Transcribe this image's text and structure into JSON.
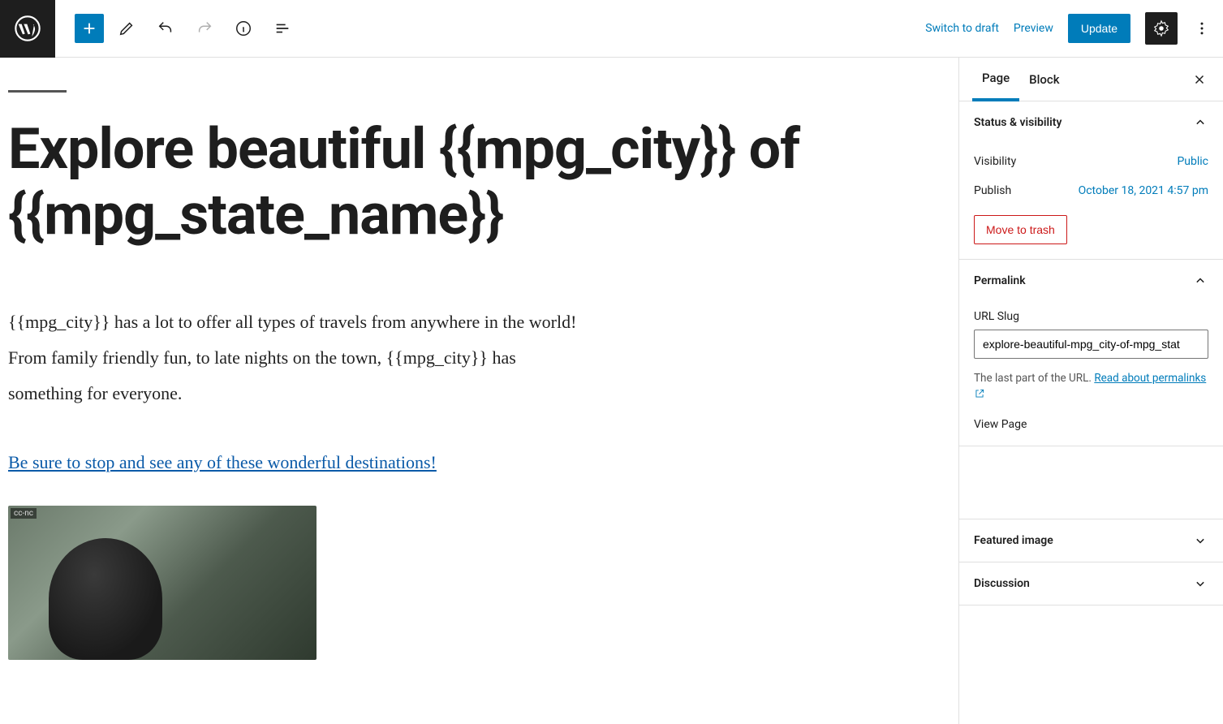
{
  "toolbar": {
    "switch_draft": "Switch to draft",
    "preview": "Preview",
    "update": "Update"
  },
  "editor": {
    "title": "Explore beautiful {{mpg_city}} of {{mpg_state_name}}",
    "paragraph": "{{mpg_city}} has a lot to offer all types of travels from anywhere in the world! From family friendly fun, to late nights on the town, {{mpg_city}} has something for everyone.",
    "link_text": "Be sure to stop and see any of these wonderful destinations!",
    "image_badge": "cc-nc"
  },
  "sidebar": {
    "tabs": {
      "page": "Page",
      "block": "Block"
    },
    "status": {
      "title": "Status & visibility",
      "visibility_label": "Visibility",
      "visibility_value": "Public",
      "publish_label": "Publish",
      "publish_value": "October 18, 2021 4:57 pm",
      "trash": "Move to trash"
    },
    "permalink": {
      "title": "Permalink",
      "slug_label": "URL Slug",
      "slug_value": "explore-beautiful-mpg_city-of-mpg_stat",
      "help_prefix": "The last part of the URL. ",
      "help_link": "Read about permalinks",
      "view_page": "View Page"
    },
    "featured": {
      "title": "Featured image"
    },
    "discussion": {
      "title": "Discussion"
    }
  }
}
